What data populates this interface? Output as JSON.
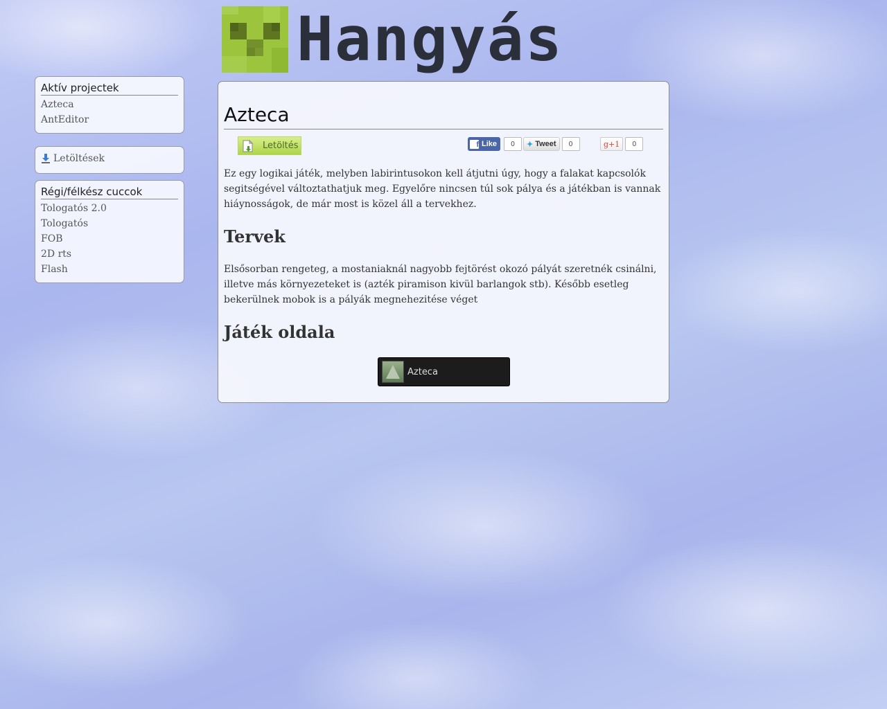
{
  "site": {
    "logo_text": "Hangyás"
  },
  "sidebar": {
    "active_projects": {
      "title": "Aktív projectek",
      "items": [
        "Azteca",
        "AntEditor"
      ]
    },
    "downloads": {
      "label": "Letöltések",
      "icon": "download-icon"
    },
    "old_projects": {
      "title": "Régi/félkész cuccok",
      "items": [
        "Tologatós 2.0",
        "Tologatós",
        "FOB",
        "2D rts",
        "Flash"
      ]
    }
  },
  "main": {
    "title": "Azteca",
    "download_button": "Letöltés",
    "social": {
      "facebook_label": "Like",
      "facebook_count": "0",
      "twitter_label": "Tweet",
      "twitter_count": "0",
      "gplus_label": "+1",
      "gplus_count": "0"
    },
    "intro": "Ez egy logikai játék, melyben labirintusokon kell átjutni úgy, hogy a falakat kapcsolók segitségével változtathatjuk meg. Egyelőre nincsen túl sok pálya és a játékban is vannak hiáynosságok, de már most is közel áll a tervekhez.",
    "plans_heading": "Tervek",
    "plans_text": "Elsősorban rengeteg, a mostaniaknál nagyobb fejtörést okozó pályát szeretnék csinálni, illetve más környezeteket is (azték piramison kivül barlangok stb). Később esetleg bekerülnek mobok is a pályák megnehezitése véget",
    "game_page_heading": "Játék oldala",
    "game_tile_name": "Azteca"
  },
  "colors": {
    "logo_green": "#9cc43c",
    "logo_dark": "#2b2f3a",
    "download_button": "#bde065",
    "facebook_blue": "#4a66a8"
  }
}
